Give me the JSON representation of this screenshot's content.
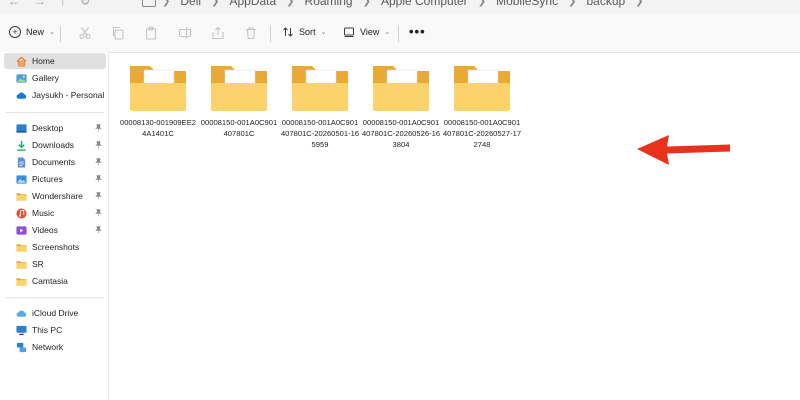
{
  "window": {
    "breadcrumbs": [
      "Dell",
      "AppData",
      "Roaming",
      "Apple Computer",
      "MobileSync",
      "backup"
    ]
  },
  "toolbar": {
    "new_label": "New",
    "sort_label": "Sort",
    "view_label": "View",
    "more_label": "•••"
  },
  "sidebar": {
    "top_items": [
      {
        "label": "Home",
        "icon": "home-icon"
      },
      {
        "label": "Gallery",
        "icon": "gallery-icon"
      },
      {
        "label": "Jaysukh - Personal",
        "icon": "onedrive-cloud-icon"
      }
    ],
    "quick_access": [
      {
        "label": "Desktop",
        "icon": "desktop-icon"
      },
      {
        "label": "Downloads",
        "icon": "download-icon"
      },
      {
        "label": "Documents",
        "icon": "documents-icon"
      },
      {
        "label": "Pictures",
        "icon": "pictures-icon"
      },
      {
        "label": "Wondershare",
        "icon": "folder-icon"
      },
      {
        "label": "Music",
        "icon": "music-icon"
      },
      {
        "label": "Videos",
        "icon": "videos-icon"
      },
      {
        "label": "Screenshots",
        "icon": "folder-icon"
      },
      {
        "label": "SR",
        "icon": "folder-icon"
      },
      {
        "label": "Camtasia",
        "icon": "folder-icon"
      }
    ],
    "bottom_items": [
      {
        "label": "iCloud Drive",
        "icon": "icloud-icon"
      },
      {
        "label": "This PC",
        "icon": "pc-icon"
      },
      {
        "label": "Network",
        "icon": "network-icon"
      }
    ]
  },
  "folders": [
    {
      "name": "00008130-001909EE24A1401C"
    },
    {
      "name": "00008150-001A0C901407801C"
    },
    {
      "name": "00008150-001A0C901407801C-20260501-165959"
    },
    {
      "name": "00008150-001A0C901407801C-20260526-163804"
    },
    {
      "name": "00008150-001A0C901407801C-20260527-172748"
    }
  ],
  "colors": {
    "folder_back": "#e8a935",
    "folder_front": "#fbd36a",
    "arrow": "#e8321e",
    "selected_bg": "#e0e0e0"
  }
}
